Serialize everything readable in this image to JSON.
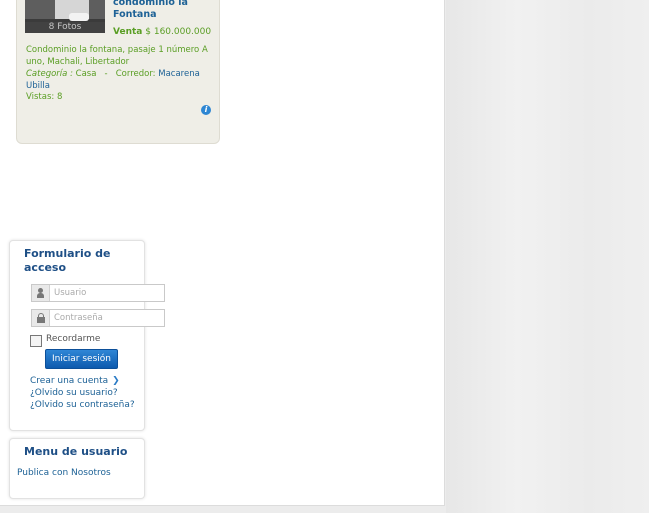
{
  "property": {
    "photo_count": "8 Fotos",
    "title": "condominio la Fontana",
    "price_kind": "Venta",
    "price": "$ 160.000.000",
    "address": "Condominio la fontana, pasaje 1 número A uno, Machali, Libertador",
    "category_label": "Categoría :",
    "category": "Casa",
    "separator": "-",
    "agent_label": "Corredor:",
    "agent": "Macarena Ubilla",
    "views_label": "Vistas:",
    "views": "8",
    "info_icon": "i"
  },
  "login": {
    "title": "Formulario de acceso",
    "username_placeholder": "Usuario",
    "password_placeholder": "Contraseña",
    "remember_label": "Recordarme",
    "submit_label": "Iniciar sesión",
    "create_account": "Crear una cuenta",
    "create_chevron": "❯",
    "forgot_username": "¿Olvido su usuario?",
    "forgot_password": "¿Olvido su contraseña?"
  },
  "user_menu": {
    "title": "Menu de usuario",
    "items": [
      "Publica con Nosotros"
    ]
  }
}
